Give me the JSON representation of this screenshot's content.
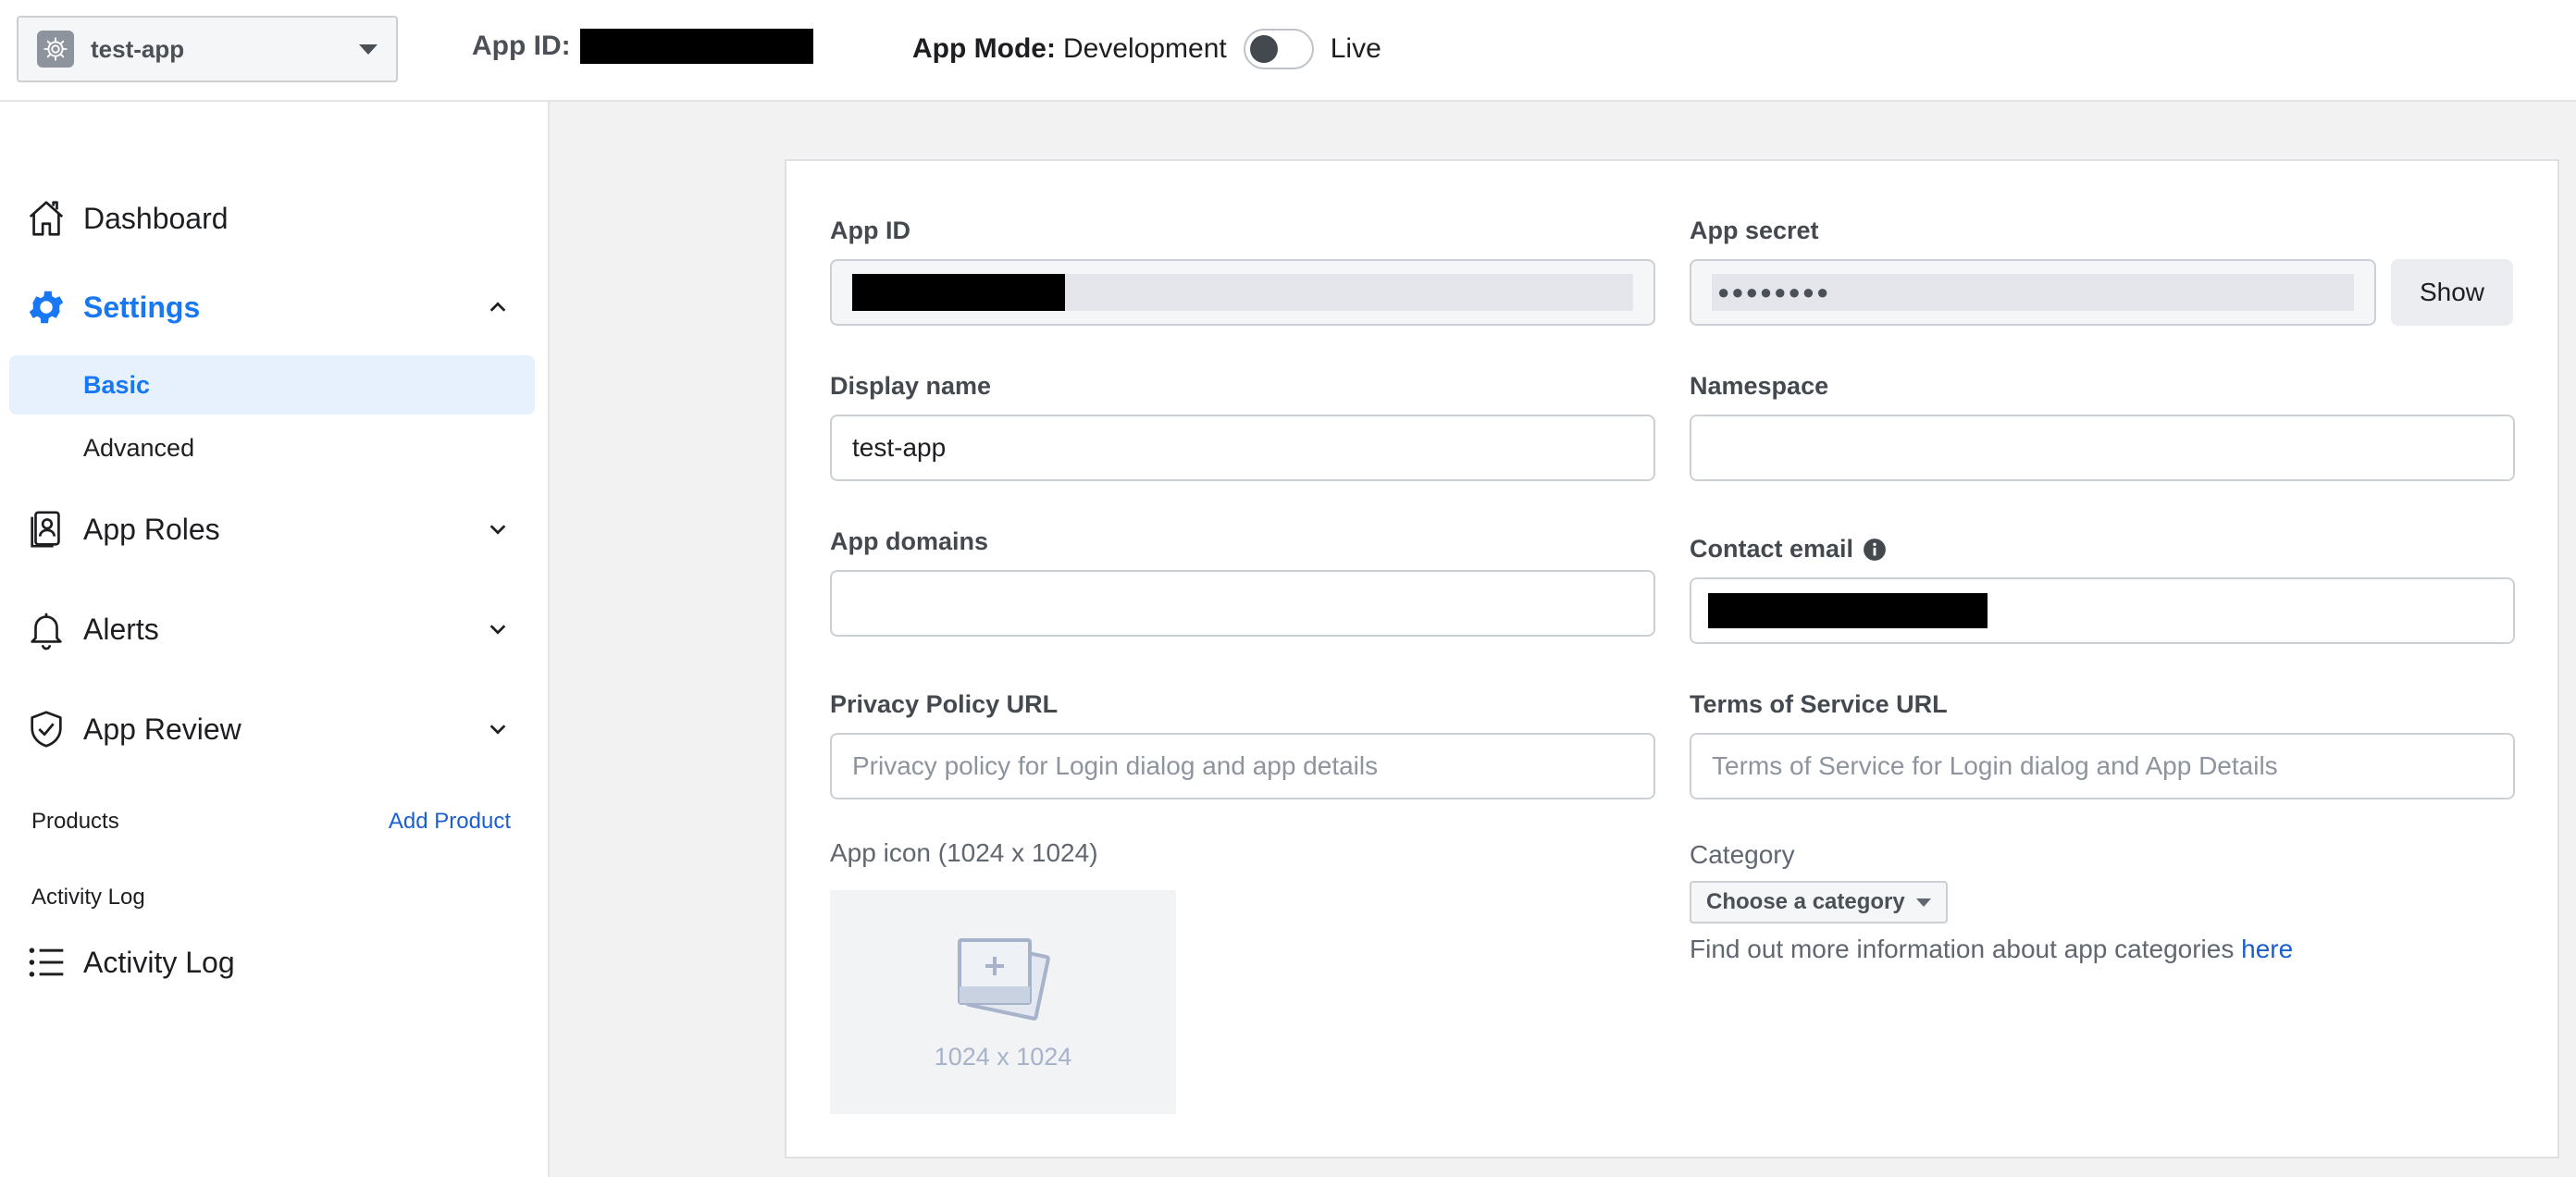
{
  "header": {
    "app_name": "test-app",
    "app_id_label": "App ID:",
    "app_mode_label": "App Mode:",
    "mode_development": "Development",
    "mode_live": "Live",
    "mode_is_live": false
  },
  "sidebar": {
    "dashboard": "Dashboard",
    "settings": "Settings",
    "settings_sub": [
      "Basic",
      "Advanced"
    ],
    "app_roles": "App Roles",
    "alerts": "Alerts",
    "app_review": "App Review",
    "products_label": "Products",
    "add_product": "Add Product",
    "activity_log_section": "Activity Log",
    "activity_log": "Activity Log"
  },
  "form": {
    "app_id_label": "App ID",
    "app_secret_label": "App secret",
    "app_secret_value": "●●●●●●●●",
    "show_button": "Show",
    "display_name_label": "Display name",
    "display_name_value": "test-app",
    "namespace_label": "Namespace",
    "namespace_value": "",
    "app_domains_label": "App domains",
    "app_domains_value": "",
    "contact_email_label": "Contact email",
    "privacy_policy_label": "Privacy Policy URL",
    "privacy_policy_placeholder": "Privacy policy for Login dialog and app details",
    "tos_label": "Terms of Service URL",
    "tos_placeholder": "Terms of Service for Login dialog and App Details",
    "app_icon_label": "App icon (1024 x 1024)",
    "app_icon_dimensions": "1024 x 1024",
    "category_label": "Category",
    "category_select": "Choose a category",
    "category_info": "Find out more information about app categories",
    "category_info_link": "here"
  },
  "colors": {
    "accent": "#1877f2",
    "link": "#1b5fcf",
    "active_bg": "#e7f0fd"
  }
}
